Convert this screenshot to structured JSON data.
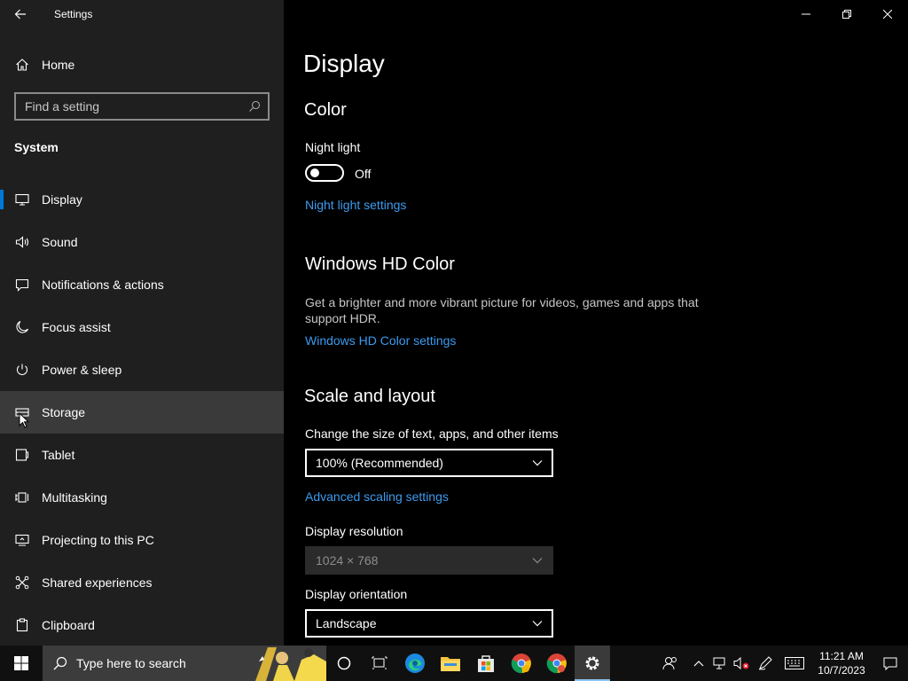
{
  "window": {
    "app_title": "Settings",
    "back_icon": "back-arrow-icon",
    "minimize_icon": "minimize-icon",
    "restore_icon": "restore-icon",
    "close_icon": "close-icon"
  },
  "sidebar": {
    "home_label": "Home",
    "search_placeholder": "Find a setting",
    "section_label": "System",
    "items": [
      {
        "label": "Display",
        "icon": "monitor-icon",
        "selected": true
      },
      {
        "label": "Sound",
        "icon": "speaker-icon"
      },
      {
        "label": "Notifications & actions",
        "icon": "message-icon"
      },
      {
        "label": "Focus assist",
        "icon": "moon-icon"
      },
      {
        "label": "Power & sleep",
        "icon": "power-icon"
      },
      {
        "label": "Storage",
        "icon": "drive-icon",
        "hover": true
      },
      {
        "label": "Tablet",
        "icon": "tablet-icon"
      },
      {
        "label": "Multitasking",
        "icon": "multitask-icon"
      },
      {
        "label": "Projecting to this PC",
        "icon": "project-icon"
      },
      {
        "label": "Shared experiences",
        "icon": "shared-icon"
      },
      {
        "label": "Clipboard",
        "icon": "clipboard-icon"
      }
    ]
  },
  "main": {
    "title": "Display",
    "color": {
      "heading": "Color",
      "night_light_label": "Night light",
      "night_light_state": "Off",
      "night_light_link": "Night light settings"
    },
    "hdr": {
      "heading": "Windows HD Color",
      "description": "Get a brighter and more vibrant picture for videos, games and apps that support HDR.",
      "link": "Windows HD Color settings"
    },
    "scale": {
      "heading": "Scale and layout",
      "size_label": "Change the size of text, apps, and other items",
      "size_value": "100% (Recommended)",
      "advanced_link": "Advanced scaling settings",
      "resolution_label": "Display resolution",
      "resolution_value": "1024 × 768",
      "orientation_label": "Display orientation",
      "orientation_value": "Landscape"
    }
  },
  "taskbar": {
    "search_text": "Type here to search",
    "time": "11:21 AM",
    "date": "10/7/2023",
    "accent": "#0078d7",
    "link_color": "#3c9bf0"
  }
}
